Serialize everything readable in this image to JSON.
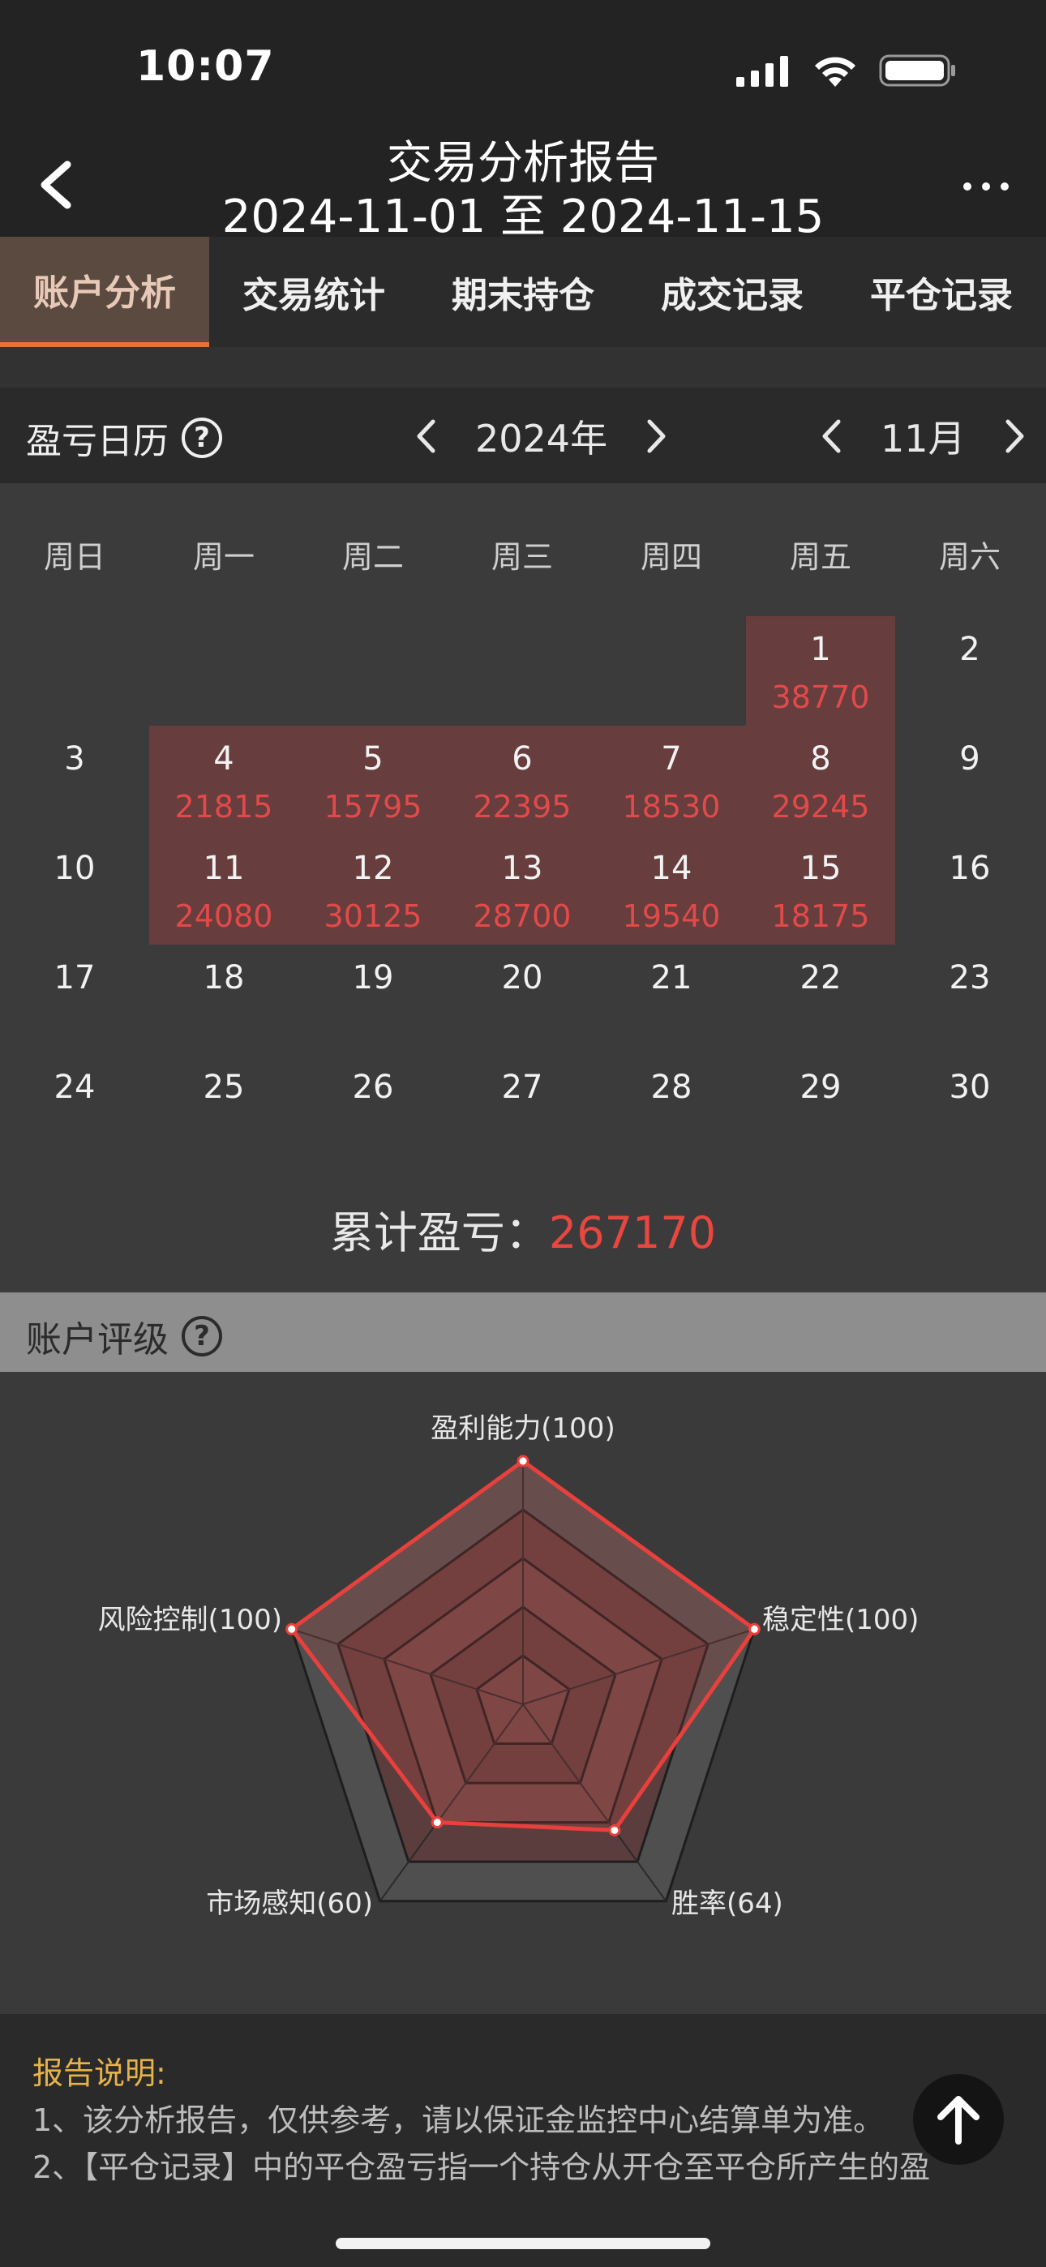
{
  "status": {
    "time": "10:07"
  },
  "nav": {
    "title": "交易分析报告",
    "subtitle": "2024-11-01 至 2024-11-15"
  },
  "tabs": [
    {
      "label": "账户分析",
      "active": true
    },
    {
      "label": "交易统计",
      "active": false
    },
    {
      "label": "期末持仓",
      "active": false
    },
    {
      "label": "成交记录",
      "active": false
    },
    {
      "label": "平仓记录",
      "active": false
    }
  ],
  "calendar": {
    "title": "盈亏日历",
    "year": "2024年",
    "month": "11月",
    "weekdays": [
      "周日",
      "周一",
      "周二",
      "周三",
      "周四",
      "周五",
      "周六"
    ],
    "days": [
      {
        "d": "1",
        "v": "38770"
      },
      {
        "d": "2",
        "v": ""
      },
      {
        "d": "3",
        "v": ""
      },
      {
        "d": "4",
        "v": "21815"
      },
      {
        "d": "5",
        "v": "15795"
      },
      {
        "d": "6",
        "v": "22395"
      },
      {
        "d": "7",
        "v": "18530"
      },
      {
        "d": "8",
        "v": "29245"
      },
      {
        "d": "9",
        "v": ""
      },
      {
        "d": "10",
        "v": ""
      },
      {
        "d": "11",
        "v": "24080"
      },
      {
        "d": "12",
        "v": "30125"
      },
      {
        "d": "13",
        "v": "28700"
      },
      {
        "d": "14",
        "v": "19540"
      },
      {
        "d": "15",
        "v": "18175"
      },
      {
        "d": "16",
        "v": ""
      },
      {
        "d": "17",
        "v": ""
      },
      {
        "d": "18",
        "v": ""
      },
      {
        "d": "19",
        "v": ""
      },
      {
        "d": "20",
        "v": ""
      },
      {
        "d": "21",
        "v": ""
      },
      {
        "d": "22",
        "v": ""
      },
      {
        "d": "23",
        "v": ""
      },
      {
        "d": "24",
        "v": ""
      },
      {
        "d": "25",
        "v": ""
      },
      {
        "d": "26",
        "v": ""
      },
      {
        "d": "27",
        "v": ""
      },
      {
        "d": "28",
        "v": ""
      },
      {
        "d": "29",
        "v": ""
      },
      {
        "d": "30",
        "v": ""
      }
    ],
    "first_weekday": 5,
    "total_label": "累计盈亏：",
    "total_value": "267170"
  },
  "rating": {
    "title": "账户评级",
    "axes": [
      {
        "label": "盈利能力(100)",
        "value": 100
      },
      {
        "label": "稳定性(100)",
        "value": 100
      },
      {
        "label": "胜率(64)",
        "value": 64
      },
      {
        "label": "市场感知(60)",
        "value": 60
      },
      {
        "label": "风险控制(100)",
        "value": 100
      }
    ],
    "max": 100,
    "line_color": "#e8403c"
  },
  "notes": {
    "title": "报告说明:",
    "line1": "1、该分析报告，仅供参考，请以保证金监控中心结算单为准。",
    "line2": "2、【平仓记录】中的平仓盈亏指一个持仓从开仓至平仓所产生的盈"
  },
  "colors": {
    "accent": "#e0753a",
    "profit": "#e24a4a",
    "profit_cell": "#673d3d"
  }
}
